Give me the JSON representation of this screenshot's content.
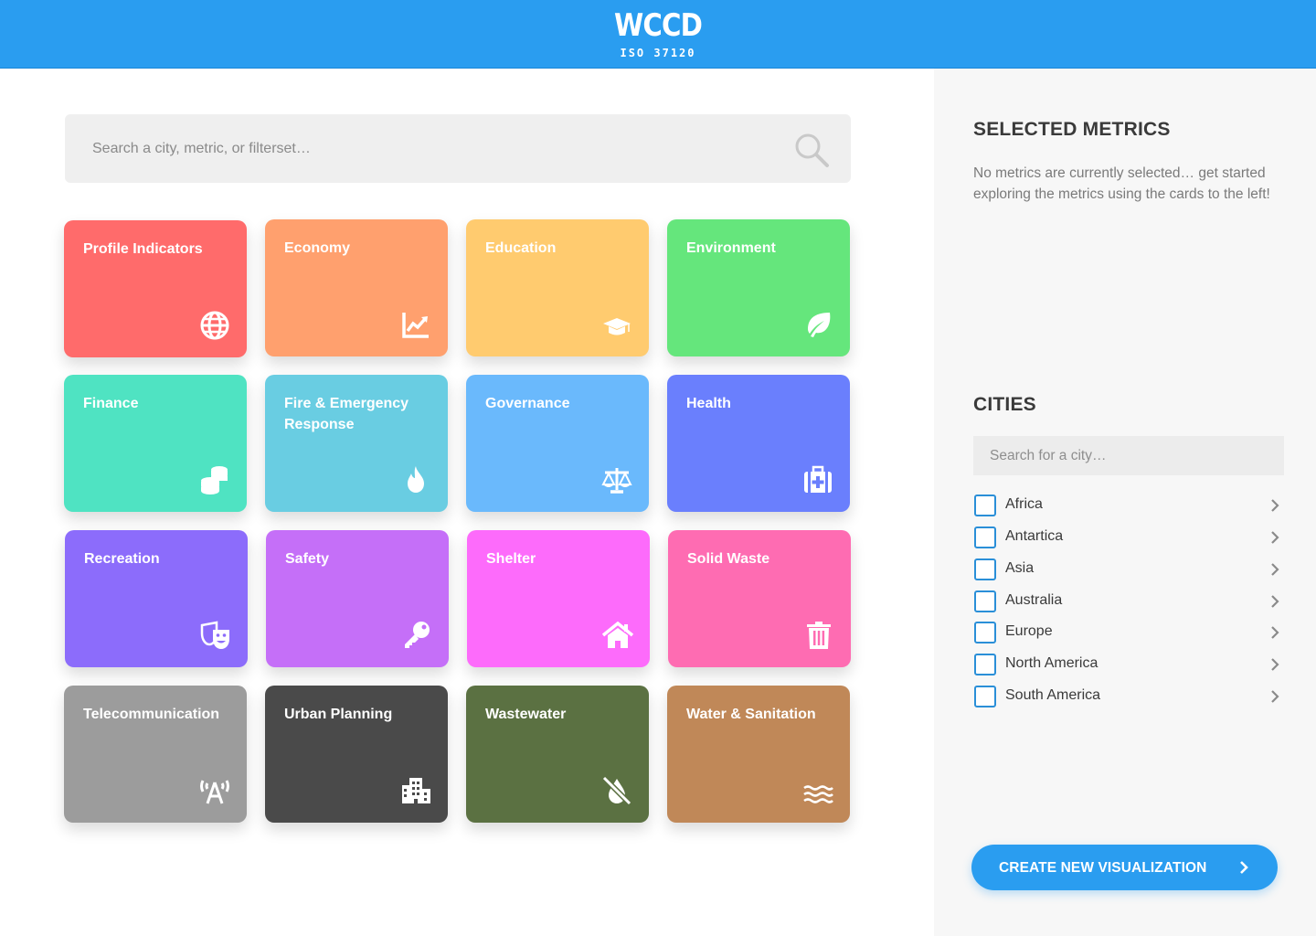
{
  "header": {
    "logo": "WCCD",
    "subtitle": "ISO 37120",
    "color": "#2a9df0"
  },
  "search": {
    "placeholder": "Search a city, metric, or filterset…",
    "icon": "search-icon"
  },
  "cards": [
    {
      "label": "Profile Indicators",
      "color": "#ff6b6b",
      "icon": "globe-icon"
    },
    {
      "label": "Economy",
      "color": "#ffa06e",
      "icon": "line-chart-icon"
    },
    {
      "label": "Education",
      "color": "#ffcb6f",
      "icon": "graduation-cap-icon"
    },
    {
      "label": "Environment",
      "color": "#65e67c",
      "icon": "leaf-icon"
    },
    {
      "label": "Finance",
      "color": "#4fe3c2",
      "icon": "coins-icon"
    },
    {
      "label": "Fire & Emergency Response",
      "color": "#69cde2",
      "icon": "flame-icon"
    },
    {
      "label": "Governance",
      "color": "#6ab9fc",
      "icon": "balance-scale-icon"
    },
    {
      "label": "Health",
      "color": "#6a7ffd",
      "icon": "medkit-icon"
    },
    {
      "label": "Recreation",
      "color": "#8c6cfb",
      "icon": "theater-masks-icon"
    },
    {
      "label": "Safety",
      "color": "#c56ff8",
      "icon": "key-icon"
    },
    {
      "label": "Shelter",
      "color": "#fd6bfb",
      "icon": "home-icon"
    },
    {
      "label": "Solid Waste",
      "color": "#fe6cb2",
      "icon": "trash-icon"
    },
    {
      "label": "Telecommunication",
      "color": "#9c9c9c",
      "icon": "antenna-icon"
    },
    {
      "label": "Urban Planning",
      "color": "#4a4a4a",
      "icon": "building-icon"
    },
    {
      "label": "Wastewater",
      "color": "#5b7142",
      "icon": "no-drop-icon"
    },
    {
      "label": "Water & Sanitation",
      "color": "#c08858",
      "icon": "water-icon"
    }
  ],
  "sidebar": {
    "selected_title": "SELECTED METRICS",
    "selected_note": "No metrics are currently selected… get started exploring the metrics using the cards to the left!",
    "cities_title": "CITIES",
    "city_search_placeholder": "Search for a city…",
    "cities": [
      {
        "label": "Africa",
        "checked": false
      },
      {
        "label": "Antartica",
        "checked": false
      },
      {
        "label": "Asia",
        "checked": false
      },
      {
        "label": "Australia",
        "checked": false
      },
      {
        "label": "Europe",
        "checked": false
      },
      {
        "label": "North America",
        "checked": false
      },
      {
        "label": "South America",
        "checked": false
      }
    ],
    "create_label": "CREATE NEW VISUALIZATION",
    "accent": "#2a8fd8"
  }
}
